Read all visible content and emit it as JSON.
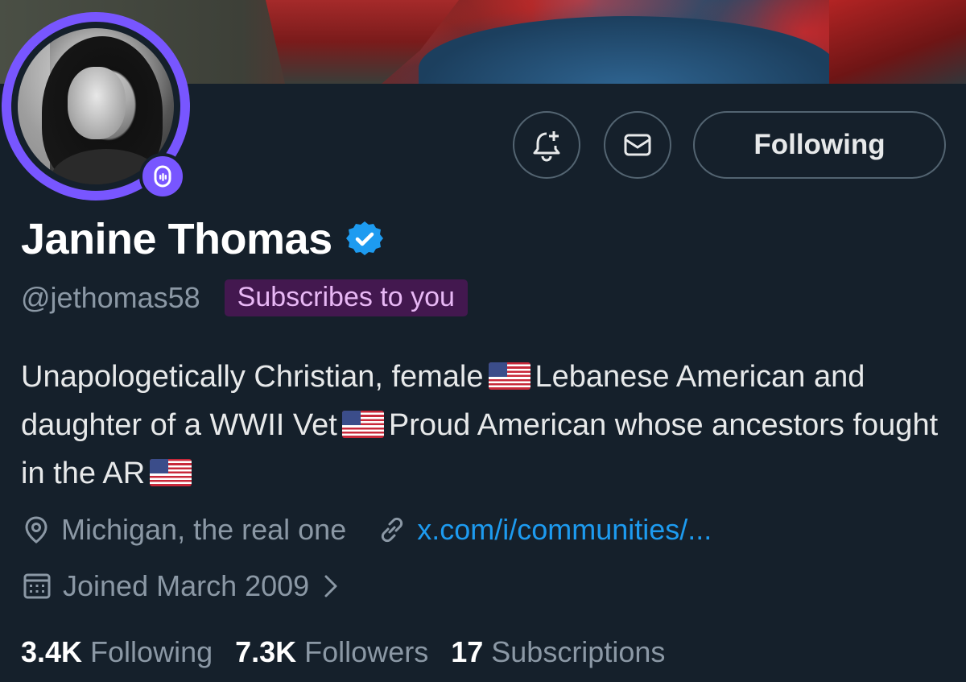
{
  "profile": {
    "name": "Janine Thomas",
    "handle": "@jethomas58",
    "subscribes_badge": "Subscribes to you",
    "bio": {
      "part1": "Unapologetically Christian, female",
      "part2": "Lebanese American and daughter of a WWII Vet",
      "part3": "Proud American whose ancestors fought in the AR"
    },
    "location": "Michigan, the real one",
    "website": "x.com/i/communities/...",
    "joined": "Joined March 2009"
  },
  "actions": {
    "following_label": "Following"
  },
  "stats": {
    "following_count": "3.4K",
    "following_label": "Following",
    "followers_count": "7.3K",
    "followers_label": "Followers",
    "subscriptions_count": "17",
    "subscriptions_label": "Subscriptions"
  },
  "colors": {
    "background": "#15202b",
    "accent_purple": "#7856ff",
    "link_blue": "#1d9bf0",
    "muted_text": "#8b98a5",
    "badge_bg": "#43184f"
  },
  "icons": {
    "notify": "bell-plus-icon",
    "message": "envelope-icon",
    "verified": "verified-badge-icon",
    "spaces": "spaces-mic-icon",
    "location": "location-pin-icon",
    "link": "link-icon",
    "calendar": "calendar-icon",
    "chevron": "chevron-right-icon"
  }
}
